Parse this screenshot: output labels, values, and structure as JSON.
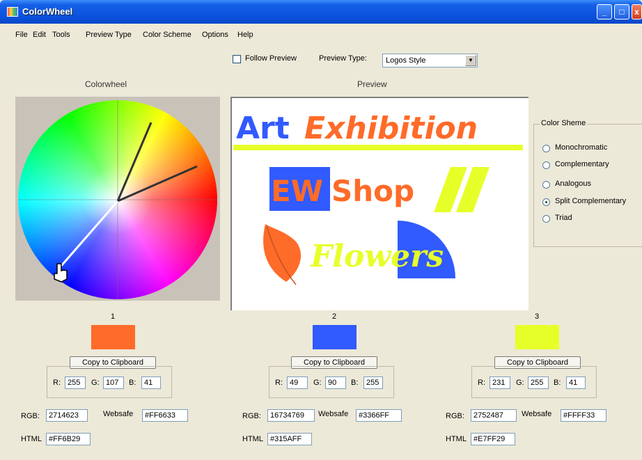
{
  "window": {
    "title": "ColorWheel"
  },
  "menu": [
    "File",
    "Edit",
    "Tools",
    "Preview Type",
    "Color Scheme",
    "Options",
    "Help"
  ],
  "toolbar": {
    "follow_preview_label": "Follow Preview",
    "follow_preview_checked": false,
    "preview_type_label": "Preview Type:",
    "preview_type_value": "Logos Style"
  },
  "sections": {
    "colorwheel": "Colorwheel",
    "preview": "Preview"
  },
  "preview": {
    "art": "Art",
    "exhibition": "Exhibition",
    "ew": "EW",
    "shop": "Shop",
    "flowers": "Flowers"
  },
  "scheme": {
    "legend": "Color Sheme",
    "options": [
      "Monochromatic",
      "Complementary",
      "Analogous",
      "Split Complementary",
      "Triad"
    ],
    "selected": "Split Complementary"
  },
  "colors": [
    {
      "num": "1",
      "swatch": "#FF6B29",
      "copy": "Copy to Clipboard",
      "r": "255",
      "g": "107",
      "b": "41",
      "rgb_label": "RGB:",
      "rgb": "2714623",
      "websafe_label": "Websafe",
      "websafe": "#FF6633",
      "html_label": "HTML",
      "html": "#FF6B29"
    },
    {
      "num": "2",
      "swatch": "#315AFF",
      "copy": "Copy to Clipboard",
      "r": "49",
      "g": "90",
      "b": "255",
      "rgb_label": "RGB:",
      "rgb": "16734769",
      "websafe_label": "Websafe",
      "websafe": "#3366FF",
      "html_label": "HTML",
      "html": "#315AFF"
    },
    {
      "num": "3",
      "swatch": "#E7FF29",
      "copy": "Copy to Clipboard",
      "r": "231",
      "g": "255",
      "b": "41",
      "rgb_label": "RGB:",
      "rgb": "2752487",
      "websafe_label": "Websafe",
      "websafe": "#FFFF33",
      "html_label": "HTML",
      "html": "#E7FF29"
    }
  ],
  "rgb_letters": {
    "r": "R:",
    "g": "G:",
    "b": "B:"
  }
}
